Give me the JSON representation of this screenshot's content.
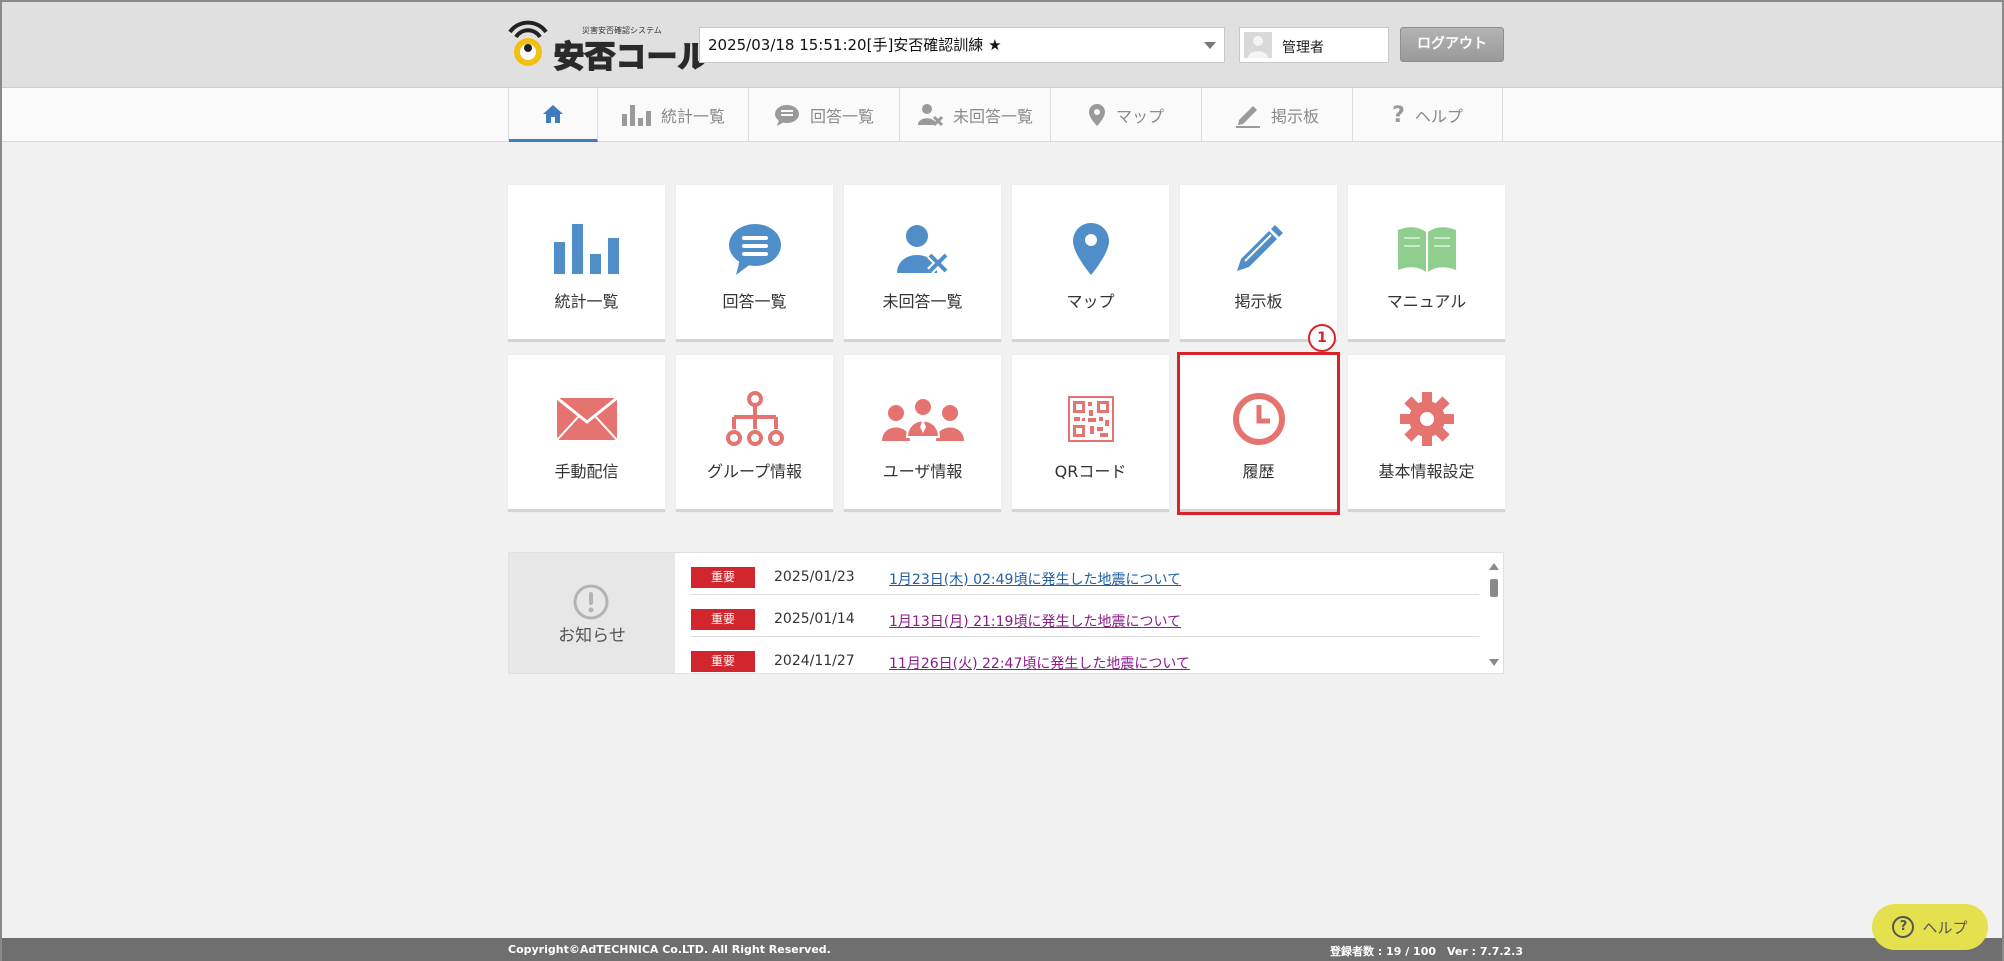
{
  "header": {
    "logo_subtitle": "災害安否確認システム",
    "logo_text": "安否コール",
    "event_selected": "2025/03/18 15:51:20[手]安否確認訓練 ★",
    "user_name": "管理者",
    "logout_label": "ログアウト"
  },
  "nav": {
    "items": [
      {
        "label": "",
        "icon": "home-icon"
      },
      {
        "label": "統計一覧",
        "icon": "bar-chart-icon"
      },
      {
        "label": "回答一覧",
        "icon": "chat-icon"
      },
      {
        "label": "未回答一覧",
        "icon": "user-x-icon"
      },
      {
        "label": "マップ",
        "icon": "map-pin-icon"
      },
      {
        "label": "掲示板",
        "icon": "pencil-icon"
      },
      {
        "label": "ヘルプ",
        "icon": "question-icon"
      }
    ]
  },
  "tiles": [
    {
      "label": "統計一覧",
      "icon": "bar-chart-icon",
      "color": "#4f8ec9"
    },
    {
      "label": "回答一覧",
      "icon": "chat-icon",
      "color": "#4f8ec9"
    },
    {
      "label": "未回答一覧",
      "icon": "user-x-icon",
      "color": "#4f8ec9"
    },
    {
      "label": "マップ",
      "icon": "map-pin-icon",
      "color": "#4f8ec9"
    },
    {
      "label": "掲示板",
      "icon": "pencil-icon",
      "color": "#4f8ec9"
    },
    {
      "label": "マニュアル",
      "icon": "book-icon",
      "color": "#8fce8f"
    },
    {
      "label": "手動配信",
      "icon": "mail-icon",
      "color": "#e5736f"
    },
    {
      "label": "グループ情報",
      "icon": "hierarchy-icon",
      "color": "#e5736f"
    },
    {
      "label": "ユーザ情報",
      "icon": "users-icon",
      "color": "#e5736f"
    },
    {
      "label": "QRコード",
      "icon": "qr-code-icon",
      "color": "#e5736f"
    },
    {
      "label": "履歴",
      "icon": "clock-icon",
      "color": "#e5736f"
    },
    {
      "label": "基本情報設定",
      "icon": "gear-icon",
      "color": "#e5736f"
    }
  ],
  "annotation_badge": "1",
  "notices": {
    "title": "お知らせ",
    "items": [
      {
        "tag": "重要",
        "date": "2025/01/23",
        "text": "1月23日(木) 02:49頃に発生した地震について"
      },
      {
        "tag": "重要",
        "date": "2025/01/14",
        "text": "1月13日(月) 21:19頃に発生した地震について"
      },
      {
        "tag": "重要",
        "date": "2024/11/27",
        "text": "11月26日(火) 22:47頃に発生した地震について"
      }
    ]
  },
  "footer": {
    "copyright": "Copyright©AdTECHNICA Co.LTD. All Right Reserved.",
    "registration": "登録者数 : 19 / 100　Ver : 7.7.2.3"
  },
  "help_button_label": "ヘルプ",
  "colors": {
    "accent": "#3f7bbf",
    "alert": "#d1262e",
    "highlight": "#d9232a",
    "help_button": "#e5e14e"
  }
}
